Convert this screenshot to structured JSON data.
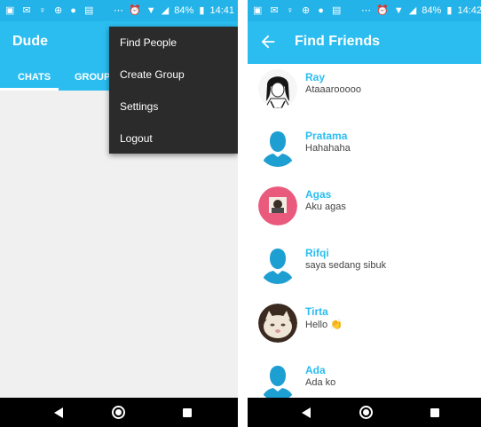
{
  "left": {
    "status": {
      "time": "14:41",
      "battery": "84%"
    },
    "app_title": "Dude",
    "tabs": [
      "CHATS",
      "GROUPS"
    ],
    "menu": [
      "Find People",
      "Create Group",
      "Settings",
      "Logout"
    ]
  },
  "right": {
    "status": {
      "time": "14:42",
      "battery": "84%"
    },
    "title": "Find Friends",
    "friends": [
      {
        "name": "Ray",
        "status": "Ataaarooooo",
        "avatar": "sketch-photo"
      },
      {
        "name": "Pratama",
        "status": "Hahahaha",
        "avatar": "default-person-icon"
      },
      {
        "name": "Agas",
        "status": "Aku agas",
        "avatar": "pink-photo"
      },
      {
        "name": "Rifqi",
        "status": "saya sedang sibuk",
        "avatar": "default-person-icon"
      },
      {
        "name": "Tirta",
        "status": "Hello 👏",
        "avatar": "cat-photo"
      },
      {
        "name": "Ada",
        "status": "Ada ko",
        "avatar": "default-person-icon"
      }
    ]
  },
  "colors": {
    "primary": "#2bbdf0",
    "status_bar": "#23b3e8",
    "menu_bg": "#2b2b2b",
    "nav_bar": "#000000"
  }
}
